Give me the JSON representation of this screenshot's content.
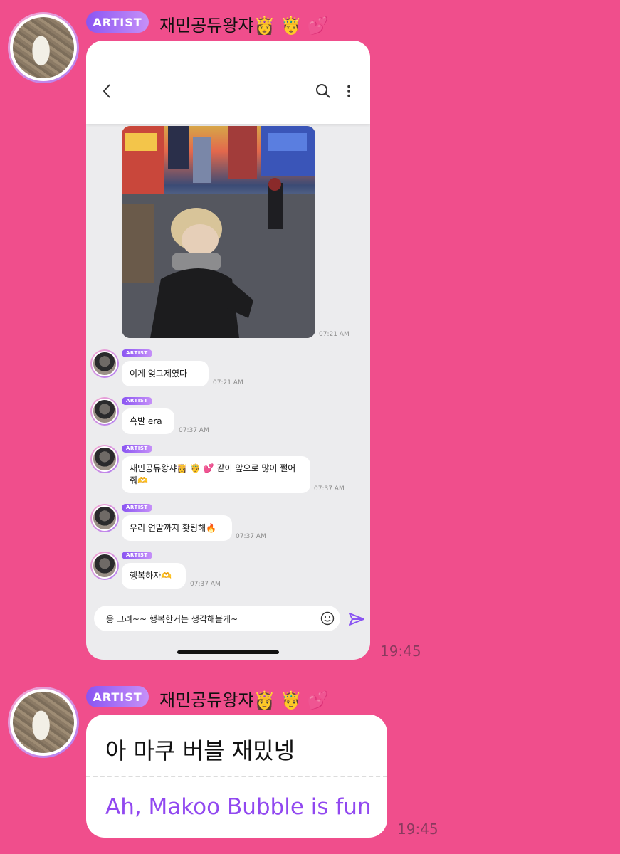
{
  "messages": [
    {
      "badge": "ARTIST",
      "sender": "재민공듀왕쟈👸 🤴 💕",
      "time": "19:45",
      "screenshot": {
        "photo_time": "07:21 AM",
        "chat": [
          {
            "badge": "ARTIST",
            "text": "이게 엊그제였다",
            "time": "07:21 AM"
          },
          {
            "badge": "ARTIST",
            "text": "흑발 era",
            "time": "07:37 AM"
          },
          {
            "badge": "ARTIST",
            "text": "재민공듀왕쟈👸 🤴 💕 같이 앞으로 많이 쩔어줘🫶",
            "time": "07:37 AM"
          },
          {
            "badge": "ARTIST",
            "text": "우리 연말까지 홧팅해🔥",
            "time": "07:37 AM"
          },
          {
            "badge": "ARTIST",
            "text": "행복하자🫶",
            "time": "07:37 AM"
          }
        ],
        "input_value": "응 그려~~ 행복한거는 생각해볼게~"
      }
    },
    {
      "badge": "ARTIST",
      "sender": "재민공듀왕쟈👸 🤴 💕",
      "time": "19:45",
      "text_ko": "아 마쿠 버블 재밌넹",
      "text_en": "Ah, Makoo Bubble is fun"
    }
  ],
  "icons": {
    "back": "chevron-left-icon",
    "search": "search-icon",
    "more": "more-vertical-icon",
    "emoji": "smiley-icon",
    "send": "send-icon"
  },
  "colors": {
    "background": "#f04e8c",
    "badge_start": "#8a55f2",
    "badge_end": "#c690f8",
    "translation_text": "#9148f0"
  }
}
